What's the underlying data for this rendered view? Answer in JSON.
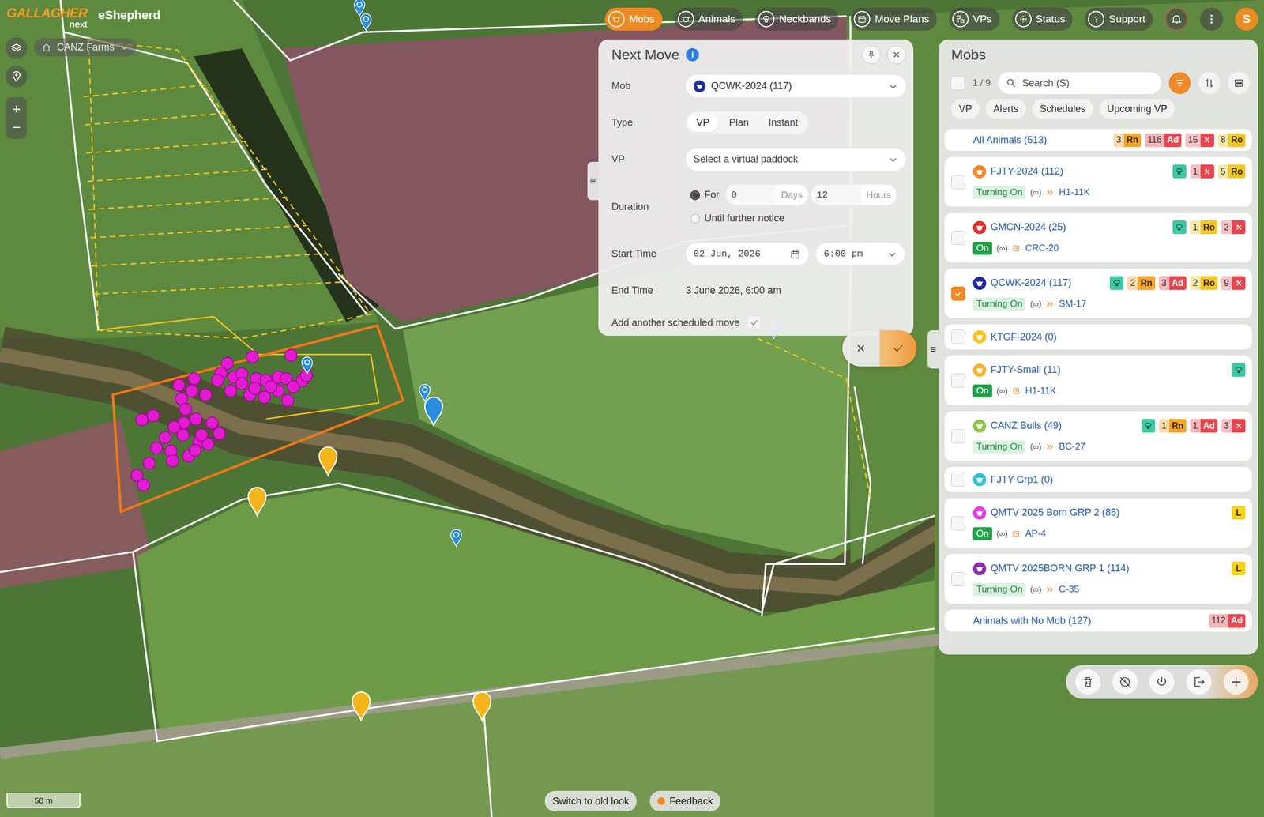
{
  "app": {
    "brand": "GALLAGHER",
    "brand_sub": "next",
    "product": "eShepherd"
  },
  "farm_selector": {
    "label": "CANZ Farms"
  },
  "map_controls": {
    "zoom_in": "+",
    "zoom_out": "−"
  },
  "nav": [
    {
      "label": "Mobs",
      "selected": true
    },
    {
      "label": "Animals",
      "selected": false
    },
    {
      "label": "Neckbands",
      "selected": false
    },
    {
      "label": "Move Plans",
      "selected": false
    },
    {
      "label": "VPs",
      "selected": false
    },
    {
      "label": "Status",
      "selected": false
    },
    {
      "label": "Support",
      "selected": false
    }
  ],
  "user": {
    "initial": "S"
  },
  "map": {
    "animals": {
      "color": "#e31cd3"
    },
    "pins": [
      {
        "kind": "marker",
        "color": "#f4b41a"
      },
      {
        "kind": "marker",
        "color": "#f4b41a"
      },
      {
        "kind": "marker",
        "color": "#f4b41a"
      },
      {
        "kind": "marker",
        "color": "#f4b41a"
      },
      {
        "kind": "marker",
        "color": "#2a8ee0"
      },
      {
        "kind": "small",
        "color": "#2a8ee0"
      },
      {
        "kind": "small",
        "color": "#2a8ee0"
      },
      {
        "kind": "small",
        "color": "#2a8ee0"
      },
      {
        "kind": "small",
        "color": "#2a8ee0"
      },
      {
        "kind": "small",
        "color": "#2a8ee0"
      },
      {
        "kind": "small",
        "color": "#2a8ee0"
      }
    ]
  },
  "scale_bar": "50 m",
  "footer_buttons": [
    {
      "label": "Switch to old look",
      "kind": "plain"
    },
    {
      "label": "Feedback",
      "kind": "dot"
    }
  ],
  "next_move": {
    "title": "Next Move",
    "info": "i",
    "mob": {
      "label": "Mob",
      "value": "QCWK-2024 (117)",
      "color": "#1e2c9c"
    },
    "type": {
      "label": "Type",
      "options": [
        {
          "label": "VP",
          "selected": true
        },
        {
          "label": "Plan",
          "selected": false
        },
        {
          "label": "Instant",
          "selected": false
        }
      ]
    },
    "vp": {
      "label": "VP",
      "placeholder": "Select a virtual paddock"
    },
    "duration": {
      "label": "Duration",
      "options": [
        {
          "label": "For",
          "selected": true
        },
        {
          "label": "Until further notice",
          "selected": false
        }
      ],
      "days": "0",
      "days_unit": "Days",
      "hours": "12",
      "hours_unit": "Hours"
    },
    "start_time": {
      "label": "Start Time",
      "date": "02 Jun, 2026",
      "time": "6:00 pm"
    },
    "end_time": {
      "label": "End Time",
      "value": "3 June 2026, 6:00 am"
    },
    "add_another": {
      "label": "Add another scheduled move",
      "checked": true
    }
  },
  "mobs_panel": {
    "title": "Mobs",
    "select_all": {
      "checked": false
    },
    "selection_count": "1 / 9",
    "search": {
      "placeholder": "Search (S)"
    },
    "filter_active": true,
    "chips": [
      {
        "label": "VP",
        "selected": false
      },
      {
        "label": "Alerts",
        "selected": false
      },
      {
        "label": "Schedules",
        "selected": false
      },
      {
        "label": "Upcoming VP",
        "selected": false
      }
    ],
    "all_animals": {
      "label": "All Animals (513)",
      "badges": [
        {
          "kind": "count",
          "count": "3",
          "label": "Rn",
          "color": "#f4a52a"
        },
        {
          "kind": "count",
          "count": "116",
          "label": "Ad",
          "color": "#e8464e"
        },
        {
          "kind": "alert",
          "count": "15",
          "color": "#e8464e"
        },
        {
          "kind": "count",
          "count": "8",
          "label": "Ro",
          "color": "#f5c624"
        }
      ]
    },
    "mobs": [
      {
        "name": "FJTY-2024 (112)",
        "color": "#f28a26",
        "checked": false,
        "badges": [
          {
            "kind": "neckband",
            "color": "#3fc9a3"
          },
          {
            "kind": "alert",
            "count": "1",
            "color": "#e8464e"
          },
          {
            "kind": "count",
            "count": "5",
            "label": "Ro",
            "color": "#f5c624"
          }
        ],
        "status": {
          "state": "Turning On",
          "kind": "turning-on",
          "duration": "(∞)",
          "vp_kind": "move",
          "vp": "H1-11K"
        }
      },
      {
        "name": "GMCN-2024 (25)",
        "color": "#e0302f",
        "checked": false,
        "badges": [
          {
            "kind": "neckband",
            "color": "#3fc9a3"
          },
          {
            "kind": "count",
            "count": "1",
            "label": "Ro",
            "color": "#f5c624"
          },
          {
            "kind": "alert",
            "count": "2",
            "color": "#e8464e"
          }
        ],
        "status": {
          "state": "On",
          "kind": "on",
          "duration": "(∞)",
          "vp_kind": "plan",
          "vp": "CRC-20"
        }
      },
      {
        "name": "QCWK-2024 (117)",
        "color": "#1e2c9c",
        "checked": true,
        "badges": [
          {
            "kind": "neckband",
            "color": "#3fc9a3"
          },
          {
            "kind": "count",
            "count": "2",
            "label": "Rn",
            "color": "#f4a52a"
          },
          {
            "kind": "count",
            "count": "3",
            "label": "Ad",
            "color": "#e8464e"
          },
          {
            "kind": "count",
            "count": "2",
            "label": "Ro",
            "color": "#f5c624"
          },
          {
            "kind": "alert",
            "count": "9",
            "color": "#e8464e"
          }
        ],
        "status": {
          "state": "Turning On",
          "kind": "turning-on",
          "duration": "(∞)",
          "vp_kind": "move",
          "vp": "SM-17"
        }
      },
      {
        "name": "KTGF-2024 (0)",
        "color": "#f6c419",
        "checked": false,
        "badges": [],
        "status": null
      },
      {
        "name": "FJTY-Small (11)",
        "color": "#f4b22a",
        "checked": false,
        "badges": [
          {
            "kind": "neckband",
            "color": "#3fc9a3"
          }
        ],
        "status": {
          "state": "On",
          "kind": "on",
          "duration": "(∞)",
          "vp_kind": "plan",
          "vp": "H1-11K"
        }
      },
      {
        "name": "CANZ Bulls (49)",
        "color": "#8cc64a",
        "checked": false,
        "badges": [
          {
            "kind": "neckband",
            "color": "#3fc9a3"
          },
          {
            "kind": "count",
            "count": "1",
            "label": "Rn",
            "color": "#f4a52a"
          },
          {
            "kind": "count",
            "count": "1",
            "label": "Ad",
            "color": "#e8464e"
          },
          {
            "kind": "alert",
            "count": "3",
            "color": "#e8464e"
          }
        ],
        "status": {
          "state": "Turning On",
          "kind": "turning-on",
          "duration": "(∞)",
          "vp_kind": "move",
          "vp": "BC-27"
        }
      },
      {
        "name": "FJTY-Grp1 (0)",
        "color": "#2ec4d8",
        "checked": false,
        "badges": [],
        "status": null
      },
      {
        "name": "QMTV 2025 Born GRP 2 (85)",
        "color": "#dc3fe6",
        "checked": false,
        "badges": [
          {
            "kind": "letter",
            "label": "L",
            "color": "#f6d31a"
          }
        ],
        "status": {
          "state": "On",
          "kind": "on",
          "duration": "(∞)",
          "vp_kind": "plan",
          "vp": "AP-4"
        }
      },
      {
        "name": "QMTV 2025BORN GRP 1 (114)",
        "color": "#8b2bb0",
        "checked": false,
        "badges": [
          {
            "kind": "letter",
            "label": "L",
            "color": "#f6d31a"
          }
        ],
        "status": {
          "state": "Turning On",
          "kind": "turning-on",
          "duration": "(∞)",
          "vp_kind": "move",
          "vp": "C-35"
        }
      }
    ],
    "no_mob": {
      "label": "Animals with No Mob (127)",
      "badges": [
        {
          "kind": "count",
          "count": "112",
          "label": "Ad",
          "color": "#e8464e"
        }
      ]
    }
  }
}
